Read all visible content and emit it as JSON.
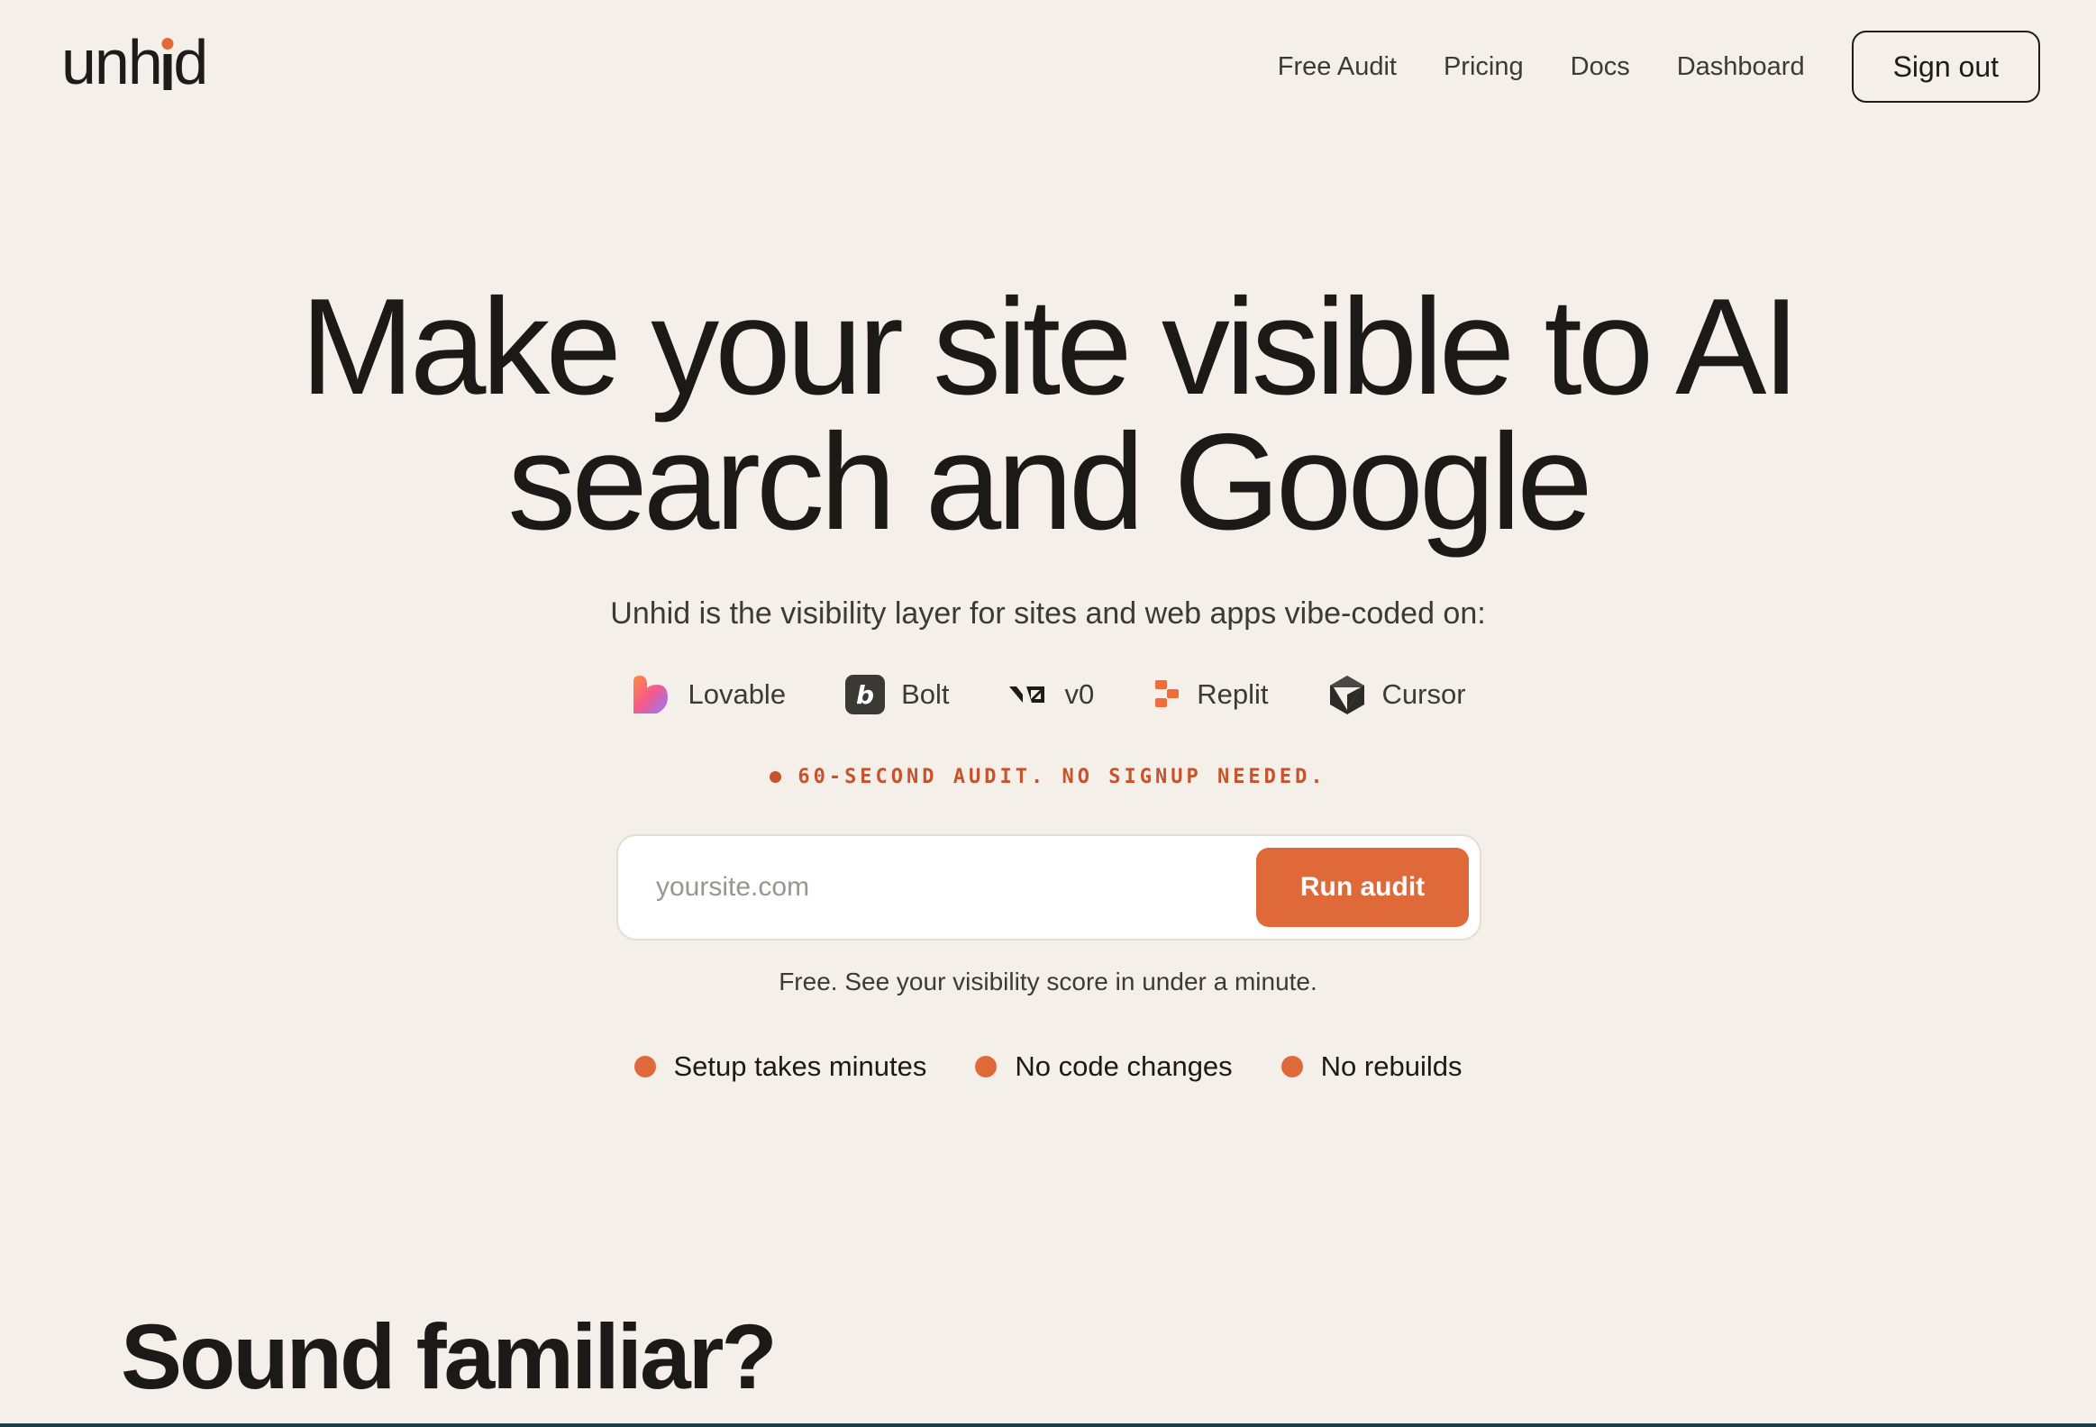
{
  "header": {
    "logo_text": "unhid",
    "nav": [
      {
        "label": "Free Audit"
      },
      {
        "label": "Pricing"
      },
      {
        "label": "Docs"
      },
      {
        "label": "Dashboard"
      }
    ],
    "sign_out_label": "Sign out"
  },
  "hero": {
    "title_line1": "Make your site visible to AI",
    "title_line2": "search and Google",
    "subtitle": "Unhid is the visibility layer for sites and web apps vibe-coded on:",
    "platforms": [
      {
        "label": "Lovable",
        "icon": "lovable-heart-icon"
      },
      {
        "label": "Bolt",
        "icon": "bolt-icon"
      },
      {
        "label": "v0",
        "icon": "v0-icon"
      },
      {
        "label": "Replit",
        "icon": "replit-icon"
      },
      {
        "label": "Cursor",
        "icon": "cursor-cube-icon"
      }
    ],
    "tagline": "60-SECOND AUDIT. NO SIGNUP NEEDED.",
    "audit_form": {
      "placeholder": "yoursite.com",
      "value": "",
      "button_label": "Run audit"
    },
    "free_note": "Free. See your visibility score in under a minute.",
    "benefits": [
      {
        "label": "Setup takes minutes"
      },
      {
        "label": "No code changes"
      },
      {
        "label": "No rebuilds"
      }
    ]
  },
  "section": {
    "title": "Sound familiar?"
  },
  "colors": {
    "background": "#f4efe8",
    "accent": "#e0693a",
    "tagline": "#c8532a",
    "text": "#1b1a18"
  }
}
